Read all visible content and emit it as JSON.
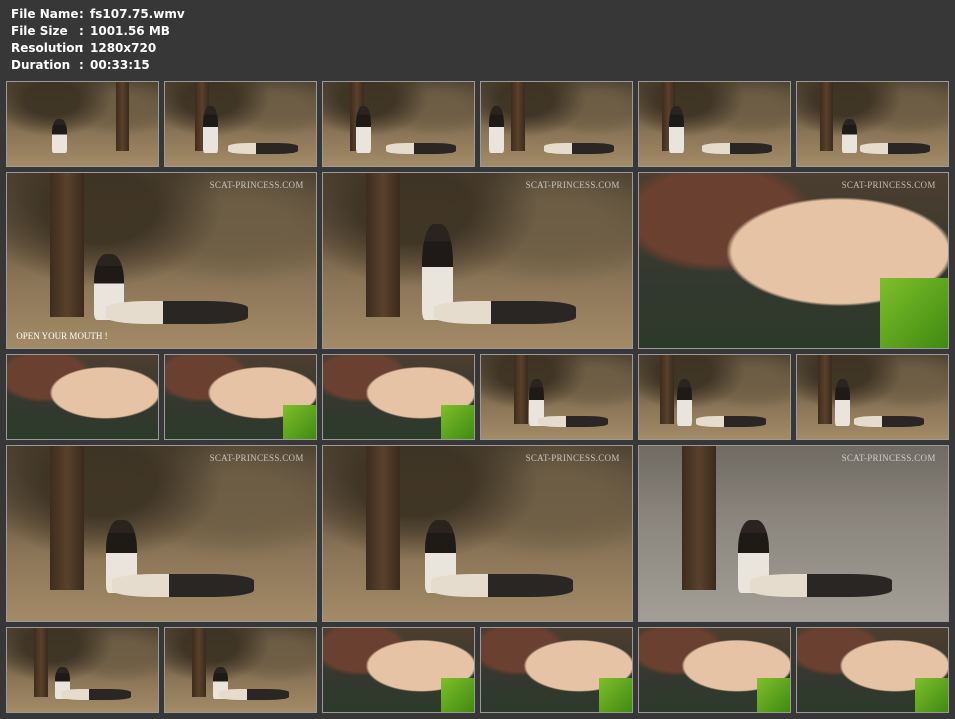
{
  "info": {
    "rows": [
      {
        "label": "File Name",
        "sep": ":",
        "value": "fs107.75.wmv"
      },
      {
        "label": "File Size",
        "sep": ":",
        "value": "1001.56 MB"
      },
      {
        "label": "Resolution",
        "sep": ":",
        "value": "1280x720"
      },
      {
        "label": "Duration",
        "sep": ":",
        "value": "00:33:15"
      }
    ]
  },
  "watermark": "SCAT-PRINCESS.COM",
  "caption": "OPEN YOUR MOUTH !",
  "colors": {
    "background": "#373737",
    "text": "#ffffff",
    "thumb_border": "#9a9a9a"
  }
}
